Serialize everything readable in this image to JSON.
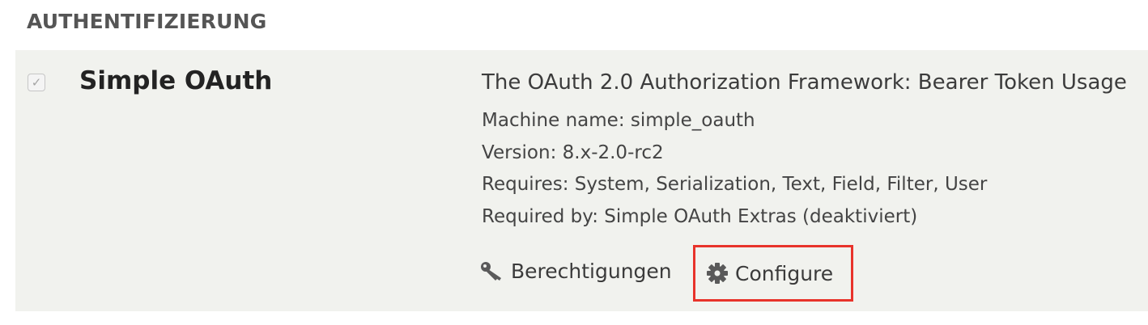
{
  "section": {
    "heading": "AUTHENTIFIZIERUNG"
  },
  "module": {
    "checked": true,
    "name": "Simple OAuth",
    "description": "The OAuth 2.0 Authorization Framework: Bearer Token Usage",
    "machine_name": "Machine name: simple_oauth",
    "version": "Version: 8.x-2.0-rc2",
    "requires": "Requires: System, Serialization, Text, Field, Filter, User",
    "required_by": "Required by: Simple OAuth Extras (deaktiviert)",
    "links": {
      "permissions_label": "Berechtigungen",
      "permissions_icon": "key-icon",
      "configure_label": "Configure",
      "configure_icon": "gear-icon"
    }
  },
  "colors": {
    "row_background": "#f1f2ee",
    "highlight_border": "#e8332b",
    "heading_text": "#555555"
  }
}
